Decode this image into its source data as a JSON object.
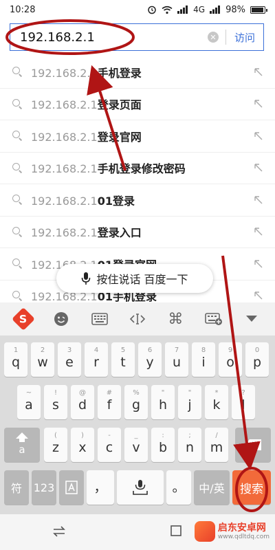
{
  "status": {
    "time": "10:28",
    "network": "4G",
    "battery_percent": "98%",
    "battery_level": 0.98
  },
  "address": {
    "value": "192.168.2.1",
    "visit_label": "访问"
  },
  "suggestions": [
    {
      "prefix": "192.168.2.1",
      "rest": "手机登录"
    },
    {
      "prefix": "192.168.2.1",
      "rest": "登录页面"
    },
    {
      "prefix": "192.168.2.1",
      "rest": "登录官网"
    },
    {
      "prefix": "192.168.2.1",
      "rest": "手机登录修改密码"
    },
    {
      "prefix": "192.168.2.1",
      "rest": "01登录"
    },
    {
      "prefix": "192.168.2.1",
      "rest": "登录入口"
    },
    {
      "prefix": "192.168.2.1",
      "rest": "01登录官网"
    },
    {
      "prefix": "192.168.2.1",
      "rest": "01手机登录"
    }
  ],
  "voice_pill": {
    "label": "按住说话 百度一下"
  },
  "keyboard": {
    "row1": [
      {
        "sub": "1",
        "main": "q"
      },
      {
        "sub": "2",
        "main": "w"
      },
      {
        "sub": "3",
        "main": "e"
      },
      {
        "sub": "4",
        "main": "r"
      },
      {
        "sub": "5",
        "main": "t"
      },
      {
        "sub": "6",
        "main": "y"
      },
      {
        "sub": "7",
        "main": "u"
      },
      {
        "sub": "8",
        "main": "i"
      },
      {
        "sub": "9",
        "main": "o"
      },
      {
        "sub": "0",
        "main": "p"
      }
    ],
    "row2": [
      {
        "sub": "~",
        "main": "a"
      },
      {
        "sub": "!",
        "main": "s"
      },
      {
        "sub": "@",
        "main": "d"
      },
      {
        "sub": "#",
        "main": "f"
      },
      {
        "sub": "%",
        "main": "g"
      },
      {
        "sub": "\"",
        "main": "h"
      },
      {
        "sub": "\"",
        "main": "j"
      },
      {
        "sub": "*",
        "main": "k"
      },
      {
        "sub": "?",
        "main": "l"
      }
    ],
    "row3": [
      {
        "sub": "(",
        "main": "z"
      },
      {
        "sub": ")",
        "main": "x"
      },
      {
        "sub": "-",
        "main": "c"
      },
      {
        "sub": "_",
        "main": "v"
      },
      {
        "sub": ":",
        "main": "b"
      },
      {
        "sub": ";",
        "main": "n"
      },
      {
        "sub": "/",
        "main": "m"
      }
    ],
    "shift_label": "a",
    "symbol_label": "符",
    "num_label": "123",
    "comma_label": "，",
    "period_label": "。",
    "lang_label": "中/英",
    "search_label": "搜索"
  },
  "watermark": {
    "name": "启东安卓网",
    "url": "www.qdltdq.com"
  },
  "colors": {
    "accent_blue": "#3a6fd8",
    "search_orange": "#f26a3a",
    "annotation_red": "#b01515",
    "sogou_red": "#e8402a"
  }
}
